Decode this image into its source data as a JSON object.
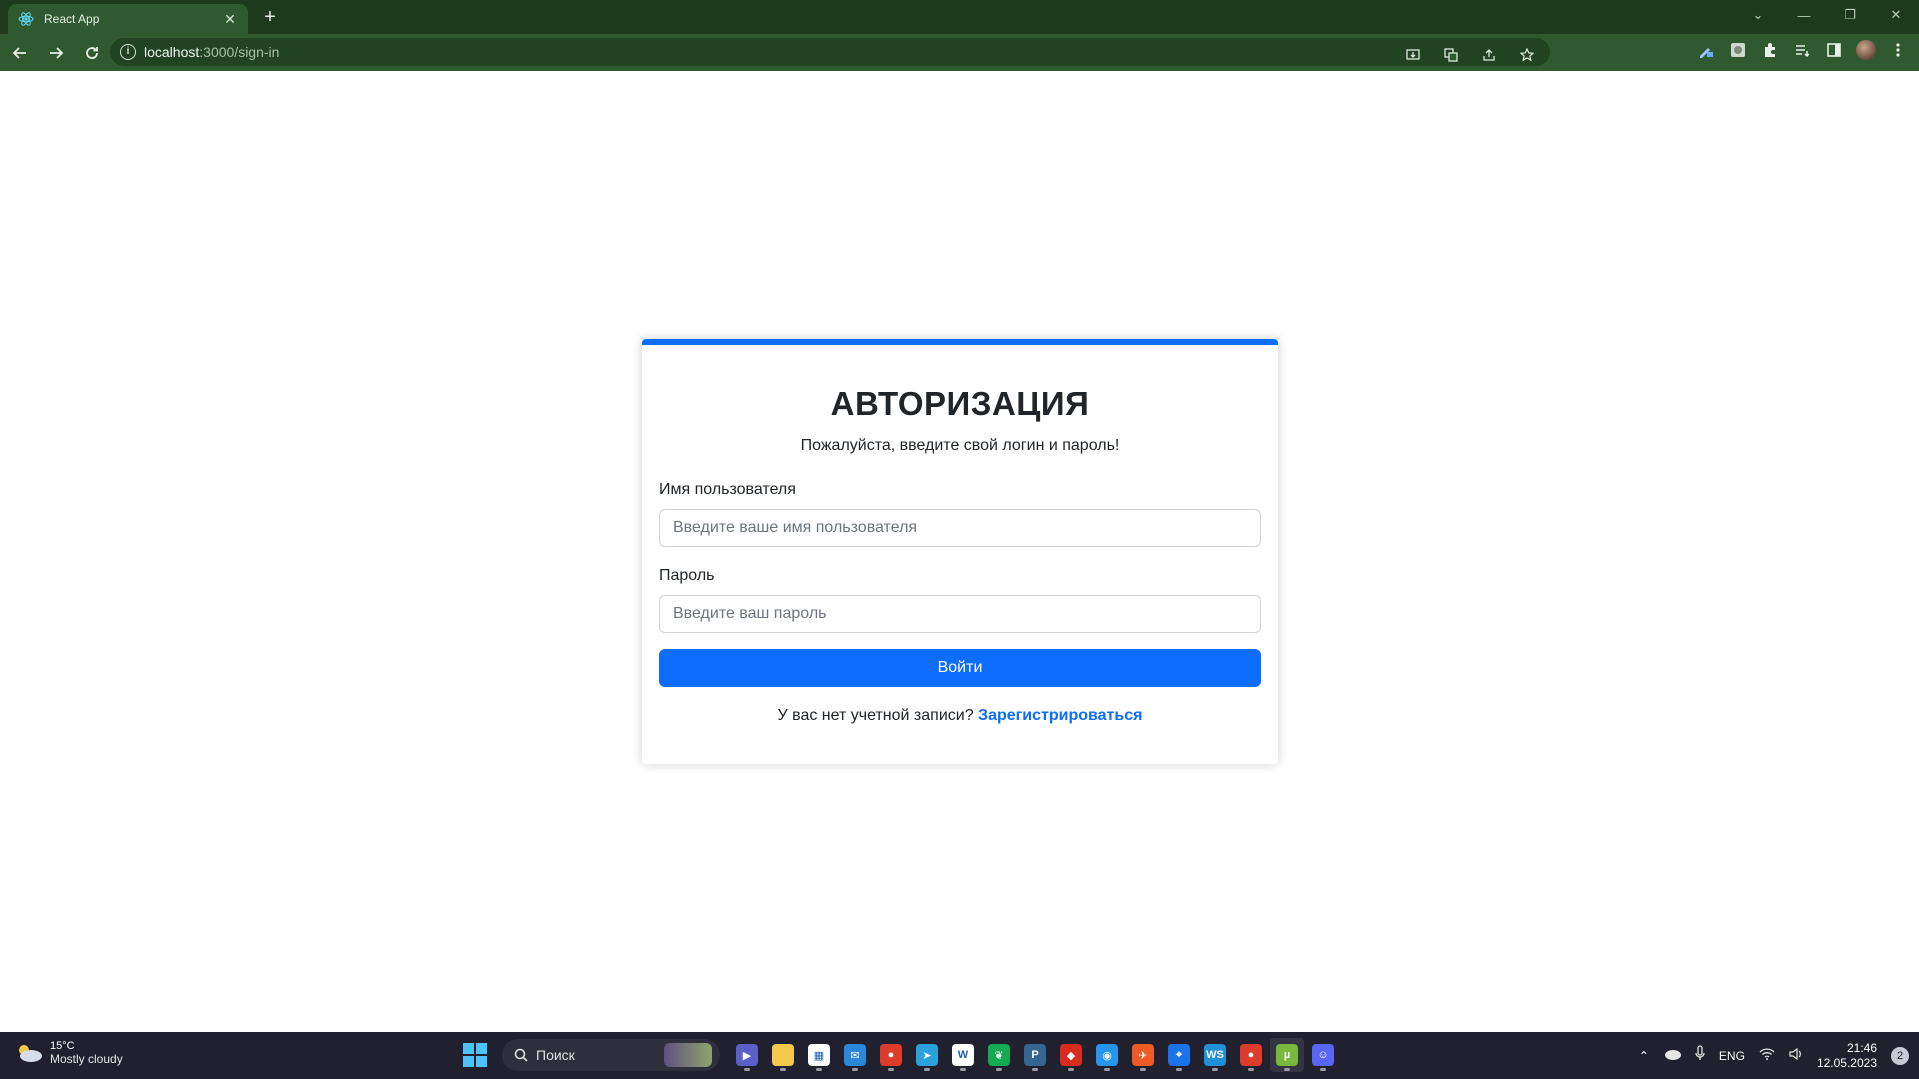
{
  "browser": {
    "tab": {
      "title": "React App"
    },
    "address": {
      "host": "localhost",
      "path": ":3000/sign-in"
    }
  },
  "auth": {
    "title": "АВТОРИЗАЦИЯ",
    "subtitle": "Пожалуйста, введите свой логин и пароль!",
    "username": {
      "label": "Имя пользователя",
      "placeholder": "Введите ваше имя пользователя",
      "value": ""
    },
    "password": {
      "label": "Пароль",
      "placeholder": "Введите ваш пароль",
      "value": ""
    },
    "submit_label": "Войти",
    "signup_prompt": "У вас нет учетной записи?",
    "signup_link": "Зарегистрироваться"
  },
  "taskbar": {
    "weather": {
      "temp": "15°C",
      "desc": "Mostly cloudy"
    },
    "search_placeholder": "Поиск",
    "apps": [
      {
        "name": "zoom-app",
        "color": "#5b5fc7",
        "glyph": "▶"
      },
      {
        "name": "file-explorer-app",
        "color": "#f2c94c",
        "glyph": ""
      },
      {
        "name": "store-app",
        "color": "#ffffff",
        "glyph": "▦"
      },
      {
        "name": "mail-app",
        "color": "#2b88d8",
        "glyph": "✉"
      },
      {
        "name": "chrome-app",
        "color": "#dd3b2b",
        "glyph": "●"
      },
      {
        "name": "telegram-app",
        "color": "#2aa1da",
        "glyph": "➤"
      },
      {
        "name": "word-app",
        "color": "#ffffff",
        "glyph": "W"
      },
      {
        "name": "mongodb-app",
        "color": "#13aa52",
        "glyph": "❦"
      },
      {
        "name": "postgres-app",
        "color": "#336791",
        "glyph": "P"
      },
      {
        "name": "redis-app",
        "color": "#d82c20",
        "glyph": "◆"
      },
      {
        "name": "docker-app",
        "color": "#2496ed",
        "glyph": "◉"
      },
      {
        "name": "postman-app",
        "color": "#ef5b25",
        "glyph": "✈"
      },
      {
        "name": "maps-app",
        "color": "#1a73e8",
        "glyph": "⌖"
      },
      {
        "name": "webstorm-app",
        "color": "#1f8fd6",
        "glyph": "WS"
      },
      {
        "name": "chrome-dev-app",
        "color": "#dd3b2b",
        "glyph": "●"
      },
      {
        "name": "utorrent-app",
        "color": "#78b83e",
        "glyph": "µ"
      },
      {
        "name": "discord-app",
        "color": "#5865f2",
        "glyph": "☺"
      }
    ],
    "lang": "ENG",
    "time": "21:46",
    "date": "12.05.2023",
    "notifications": "2"
  },
  "colors": {
    "accent": "#0d6efd",
    "tabstrip": "#1d3a1d",
    "toolbar": "#2f5a2f",
    "taskbar": "#20202e"
  }
}
